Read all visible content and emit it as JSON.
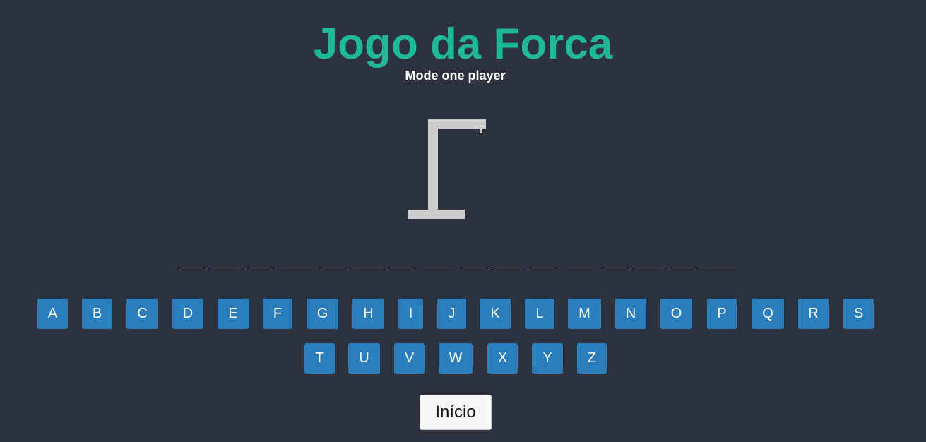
{
  "header": {
    "title": "Jogo da Forca",
    "subtitle": "Mode one player"
  },
  "game": {
    "mode": "one player",
    "word_length": 16,
    "wrong_guesses": 0,
    "gallows_icon": "gallows-icon"
  },
  "keyboard": {
    "letters": [
      "A",
      "B",
      "C",
      "D",
      "E",
      "F",
      "G",
      "H",
      "I",
      "J",
      "K",
      "L",
      "M",
      "N",
      "O",
      "P",
      "Q",
      "R",
      "S",
      "T",
      "U",
      "V",
      "W",
      "X",
      "Y",
      "Z"
    ]
  },
  "controls": {
    "start_label": "Início"
  },
  "colors": {
    "background": "#2c323e",
    "title": "#1fb899",
    "key": "#2a7ebd",
    "gallows": "#cccccc"
  }
}
